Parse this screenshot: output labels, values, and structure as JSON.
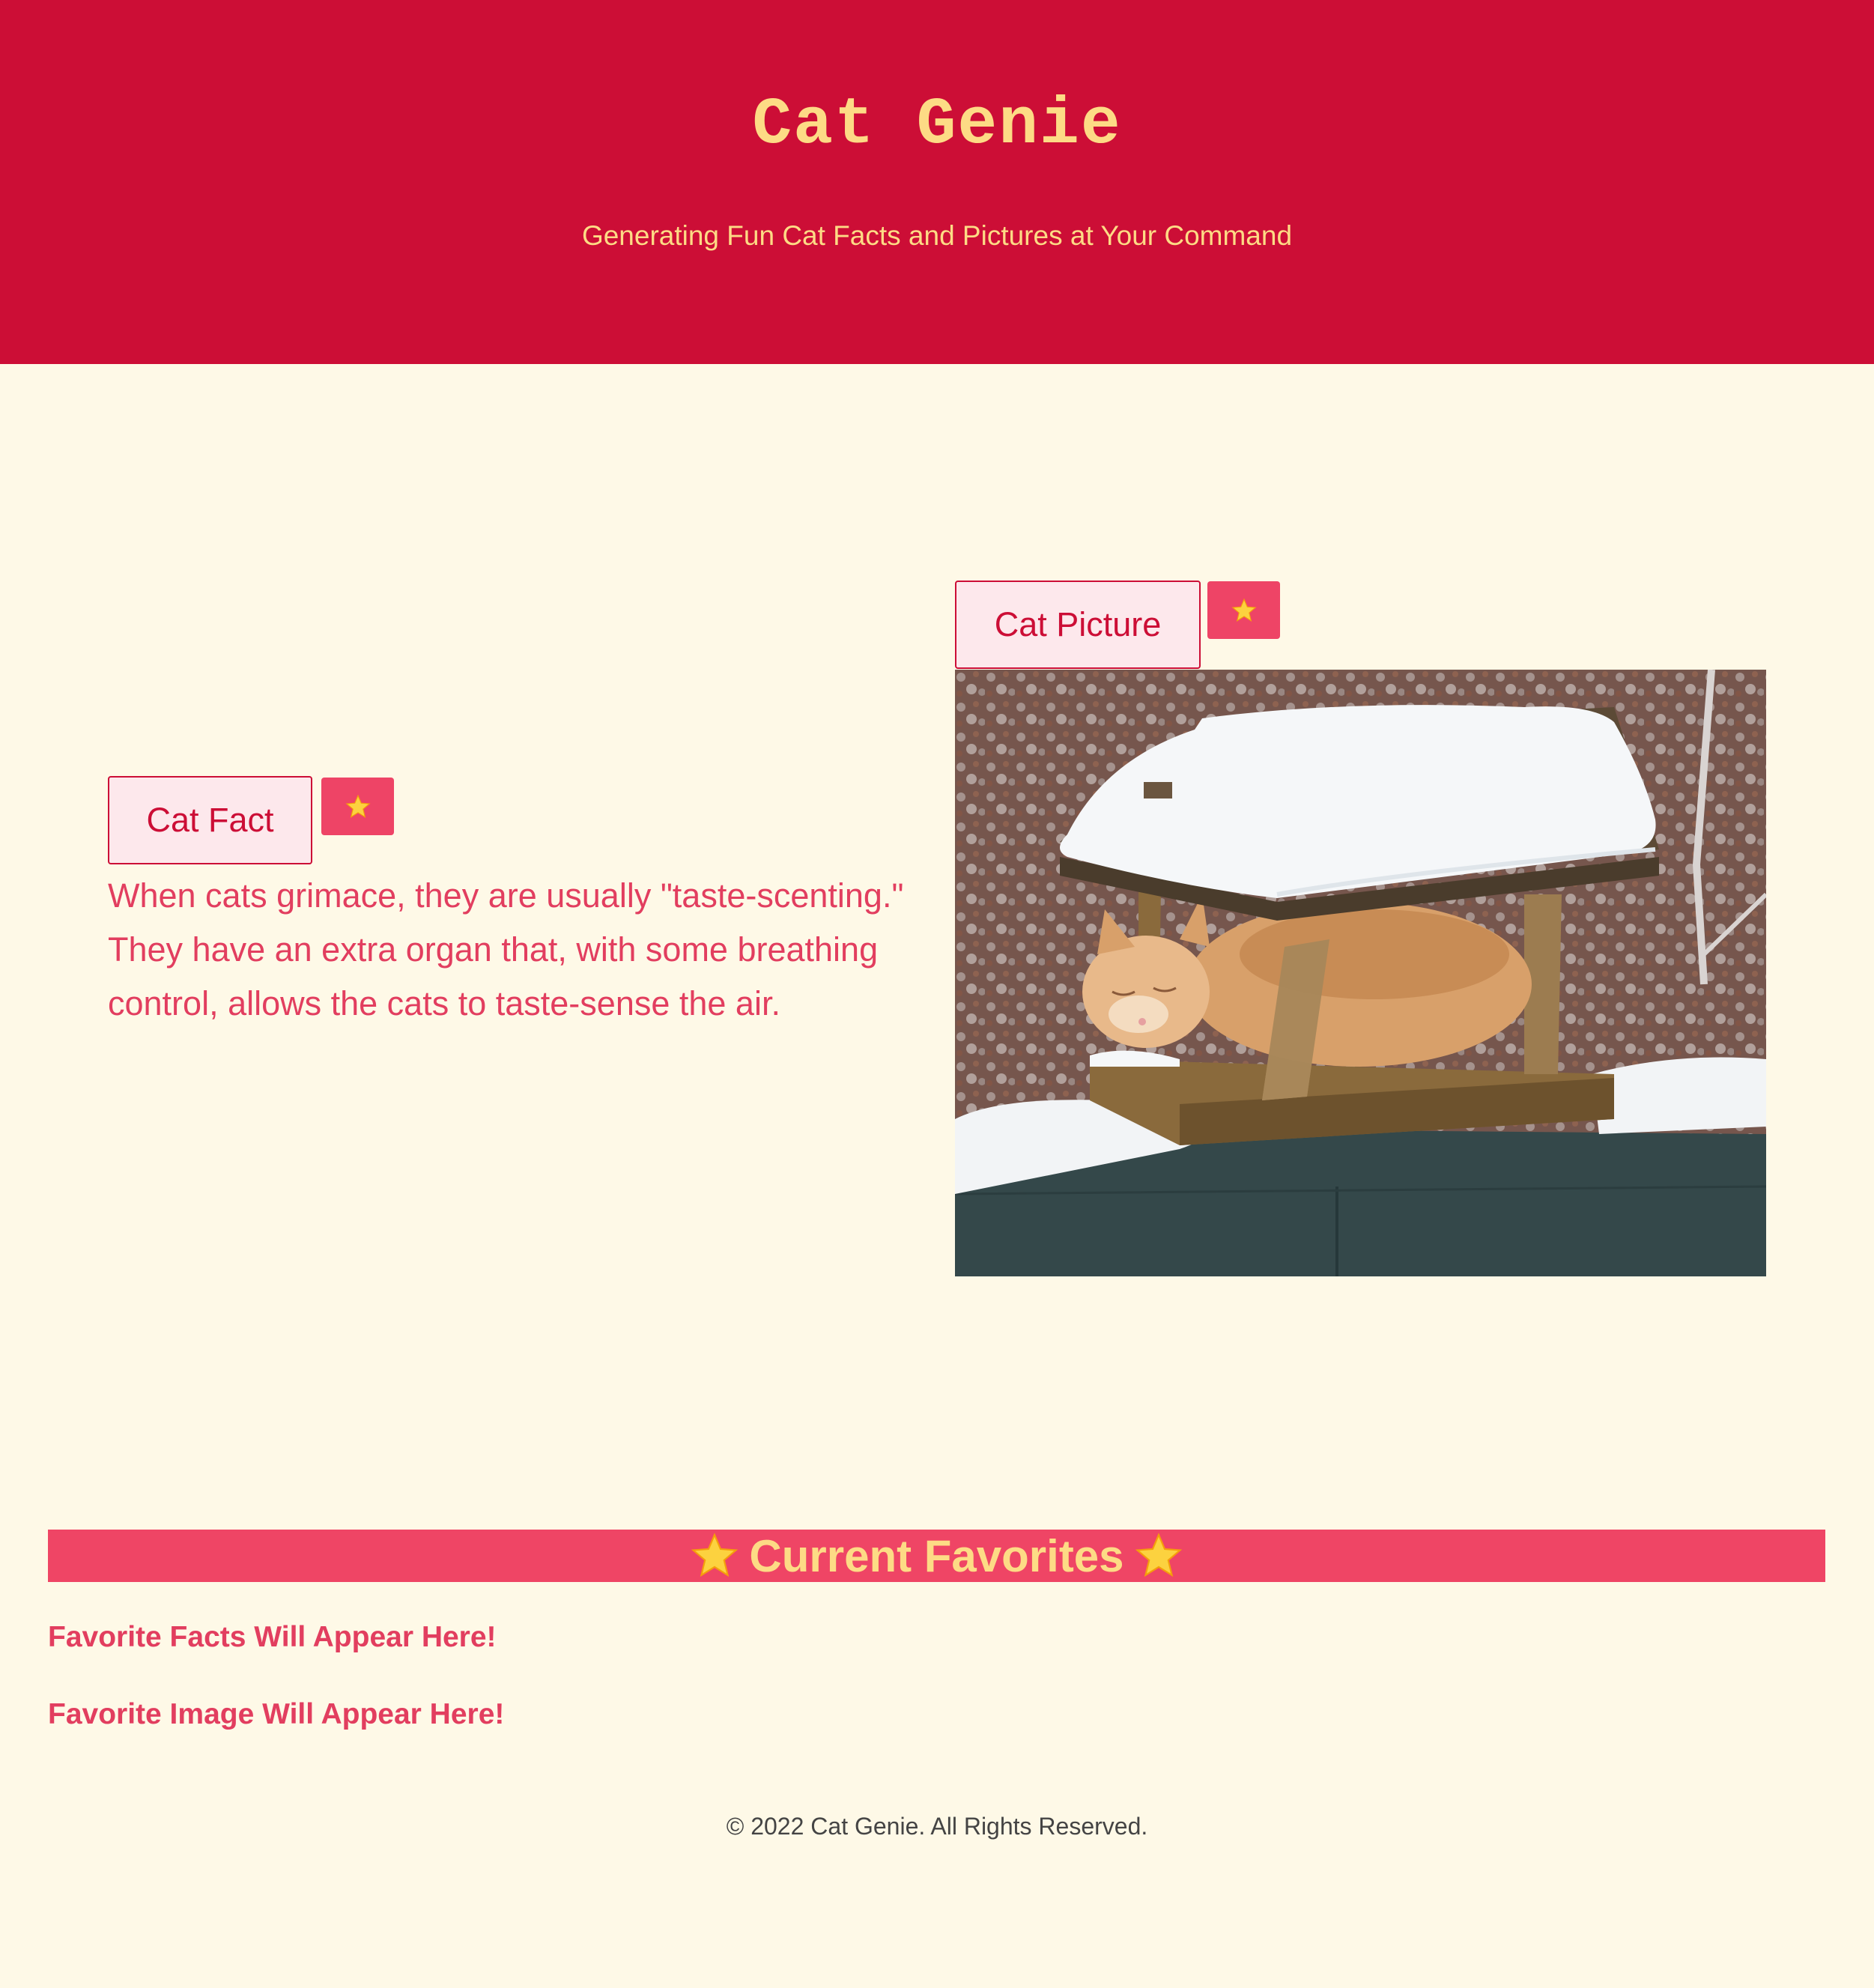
{
  "header": {
    "title": "Cat Genie",
    "subtitle": "Generating Fun Cat Facts and Pictures at Your Command"
  },
  "fact_panel": {
    "button_label": "Cat Fact",
    "favorite_icon": "star-icon",
    "fact_text": "When cats grimace, they are usually \"taste-scenting.\" They have an extra organ that, with some breathing control, allows the cats to taste-sense the air."
  },
  "picture_panel": {
    "button_label": "Cat Picture",
    "favorite_icon": "star-icon",
    "image_alt": "orange cat sleeping in snowy bird feeder"
  },
  "favorites": {
    "heading": "Current Favorites",
    "facts_placeholder": "Favorite Facts Will Appear Here!",
    "image_placeholder": "Favorite Image Will Appear Here!"
  },
  "footer": {
    "copyright": "© 2022 Cat Genie. All Rights Reserved."
  },
  "colors": {
    "header_bg": "#cc0e36",
    "header_text": "#fddb85",
    "page_bg": "#fef9e7",
    "accent": "#ef4565",
    "button_bg": "#fde8ec"
  }
}
